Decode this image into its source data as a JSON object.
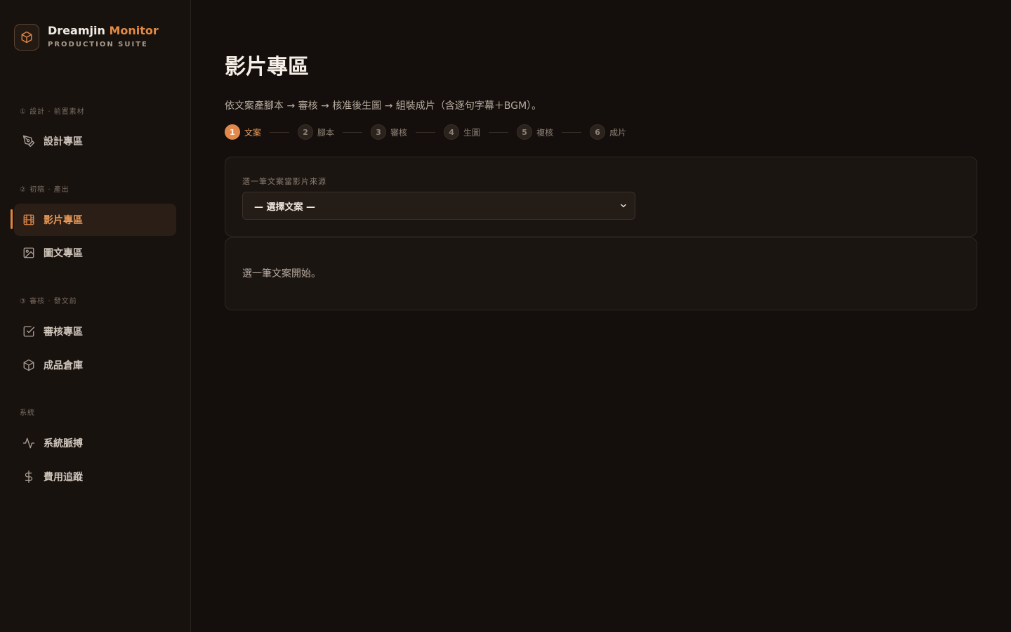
{
  "brand": {
    "name_part1": "Dreamjin",
    "name_part2": "Monitor",
    "subtitle": "PRODUCTION SUITE"
  },
  "sidebar": {
    "sections": [
      {
        "label": "① 設計 · 前置素材"
      },
      {
        "label": "② 初稿 · 產出"
      },
      {
        "label": "③ 審核 · 發文前"
      },
      {
        "label": "系統"
      }
    ],
    "items": [
      {
        "label": "設計專區",
        "icon": "pen-tool-icon"
      },
      {
        "label": "影片專區",
        "icon": "film-icon",
        "active": true
      },
      {
        "label": "圖文專區",
        "icon": "image-icon"
      },
      {
        "label": "審核專區",
        "icon": "check-square-icon"
      },
      {
        "label": "成品倉庫",
        "icon": "package-icon"
      },
      {
        "label": "系統脈搏",
        "icon": "activity-icon"
      },
      {
        "label": "費用追蹤",
        "icon": "dollar-icon"
      }
    ]
  },
  "page": {
    "title": "影片專區",
    "description": "依文案產腳本 → 審核 → 核准後生圖 → 組裝成片（含逐句字幕＋BGM）。"
  },
  "steps": [
    {
      "num": "1",
      "label": "文案",
      "active": true
    },
    {
      "num": "2",
      "label": "腳本"
    },
    {
      "num": "3",
      "label": "審核"
    },
    {
      "num": "4",
      "label": "生圖"
    },
    {
      "num": "5",
      "label": "複核"
    },
    {
      "num": "6",
      "label": "成片"
    }
  ],
  "source_card": {
    "field_label": "選一筆文案當影片來源",
    "select_value": "— 選擇文案 —"
  },
  "empty_state": {
    "text": "選一筆文案開始。"
  },
  "colors": {
    "accent": "#e2884a",
    "background": "#140f0c",
    "sidebar": "#18120f"
  }
}
